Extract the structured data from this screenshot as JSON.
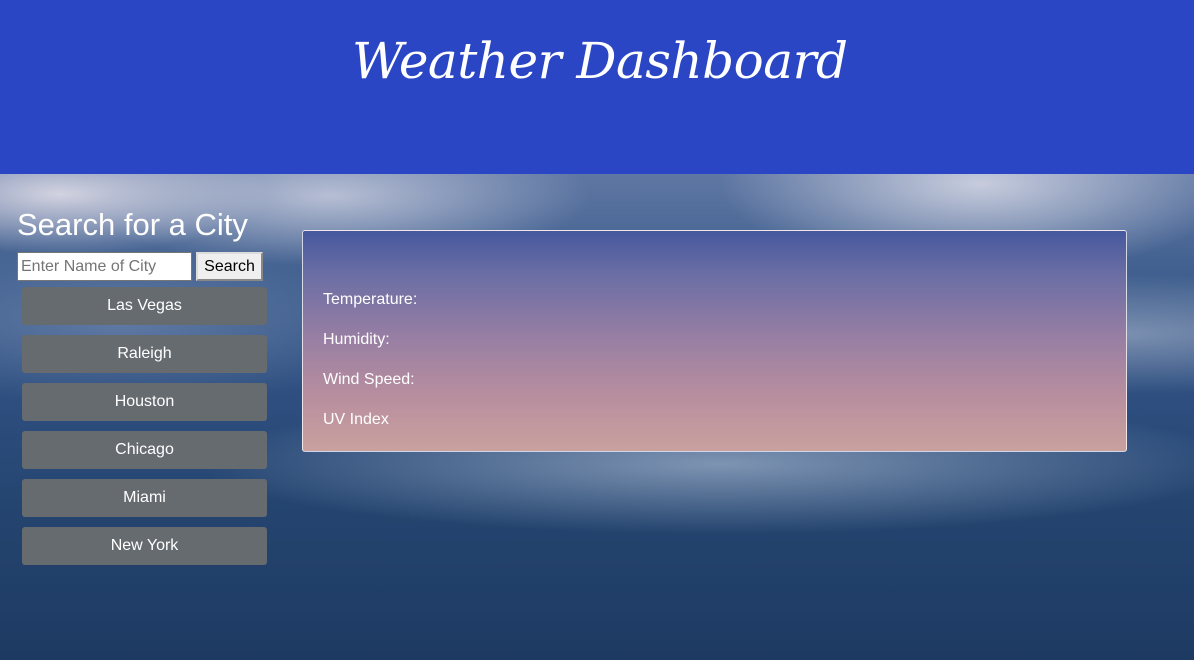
{
  "header": {
    "title": "Weather Dashboard",
    "background_color": "#2a46c5"
  },
  "sidebar": {
    "title": "Search for a City",
    "search": {
      "placeholder": "Enter Name of City",
      "value": "",
      "button_label": "Search"
    },
    "cities": [
      "Las Vegas",
      "Raleigh",
      "Houston",
      "Chicago",
      "Miami",
      "New York"
    ],
    "city_button_color": "#666b70"
  },
  "weather_card": {
    "city": "",
    "labels": {
      "temperature": "Temperature:",
      "humidity": "Humidity:",
      "wind_speed": "Wind Speed:",
      "uv_index": "UV Index"
    },
    "values": {
      "temperature": "",
      "humidity": "",
      "wind_speed": "",
      "uv_index": ""
    }
  }
}
